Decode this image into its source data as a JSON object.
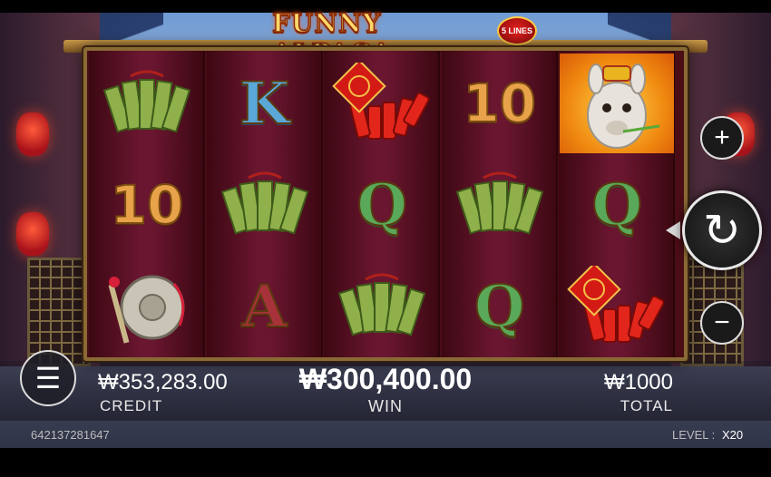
{
  "game": {
    "title": "FUNNY ALPACA",
    "lines_badge": "5 LINES"
  },
  "reels": [
    {
      "symbols": [
        {
          "kind": "fan",
          "label": ""
        },
        {
          "kind": "ten",
          "label": "10"
        },
        {
          "kind": "gong",
          "label": ""
        }
      ]
    },
    {
      "symbols": [
        {
          "kind": "letter-k",
          "label": "K"
        },
        {
          "kind": "fan",
          "label": ""
        },
        {
          "kind": "letter-a",
          "label": "A"
        }
      ]
    },
    {
      "symbols": [
        {
          "kind": "firecracker",
          "label": ""
        },
        {
          "kind": "letter-q",
          "label": "Q"
        },
        {
          "kind": "fan",
          "label": ""
        }
      ]
    },
    {
      "symbols": [
        {
          "kind": "ten",
          "label": "10"
        },
        {
          "kind": "fan",
          "label": ""
        },
        {
          "kind": "letter-q",
          "label": "Q"
        }
      ]
    },
    {
      "symbols": [
        {
          "kind": "alpaca",
          "label": ""
        },
        {
          "kind": "letter-q",
          "label": "Q"
        },
        {
          "kind": "firecracker",
          "label": ""
        }
      ]
    }
  ],
  "controls": {
    "plus_icon": "+",
    "minus_icon": "−",
    "spin_icon": "↻",
    "menu_icon": "☰"
  },
  "info": {
    "credit_value": "₩353,283.00",
    "credit_label": "CREDIT",
    "win_value": "₩300,400.00",
    "win_label": "WIN",
    "total_value": "₩1000",
    "total_label": "TOTAL",
    "session_id": "642137281647",
    "level_label": "LEVEL :",
    "level_value": "X20"
  },
  "colors": {
    "frame_gold": "#8a6a34",
    "reel_bg": "#6a1630",
    "ten_orange": "#e8a24a",
    "k_blue": "#5aa8d8",
    "q_green": "#5aa85a",
    "a_red": "#a8323a"
  }
}
